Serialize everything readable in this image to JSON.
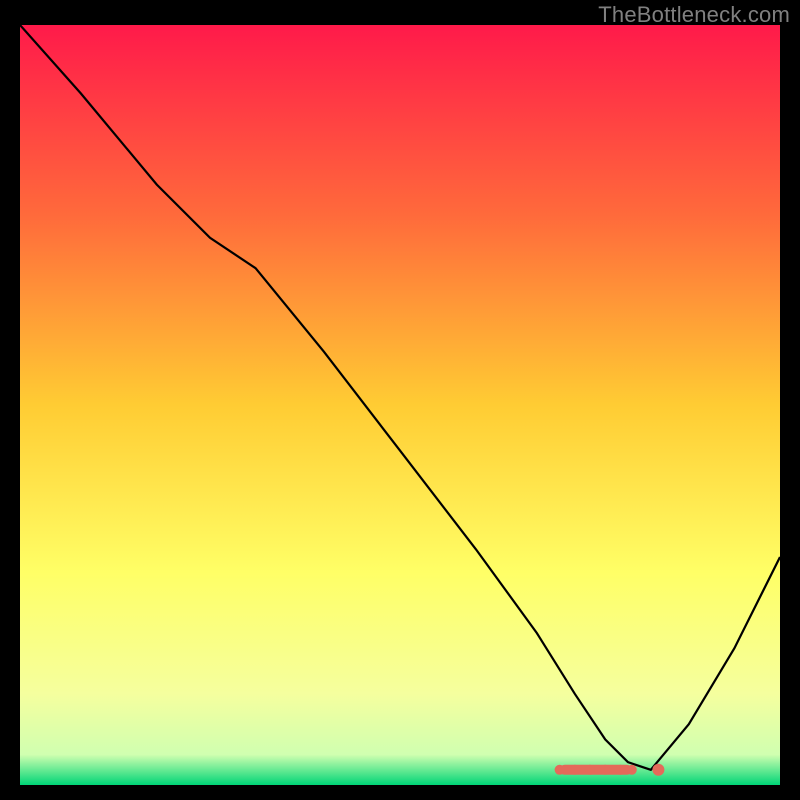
{
  "watermark": "TheBottleneck.com",
  "chart_data": {
    "type": "line",
    "title": "",
    "xlabel": "",
    "ylabel": "",
    "xlim": [
      0,
      100
    ],
    "ylim": [
      0,
      100
    ],
    "grid": false,
    "background": "rainbow-gradient-vertical",
    "gradient_stops": [
      {
        "offset": 0,
        "color": "#ff1a4a"
      },
      {
        "offset": 0.25,
        "color": "#ff6a3b"
      },
      {
        "offset": 0.5,
        "color": "#ffcc33"
      },
      {
        "offset": 0.72,
        "color": "#ffff66"
      },
      {
        "offset": 0.88,
        "color": "#f5ff9e"
      },
      {
        "offset": 0.96,
        "color": "#d0ffb0"
      },
      {
        "offset": 1.0,
        "color": "#00d577"
      }
    ],
    "series": [
      {
        "name": "bottleneck-curve",
        "color": "#000000",
        "x": [
          0,
          8,
          18,
          25,
          31,
          40,
          50,
          60,
          68,
          73,
          77,
          80,
          83,
          88,
          94,
          100
        ],
        "values": [
          100,
          91,
          79,
          72,
          68,
          57,
          44,
          31,
          20,
          12,
          6,
          3,
          2,
          8,
          18,
          30
        ]
      }
    ],
    "markers": {
      "name": "highlight-cluster",
      "color": "#e46a5a",
      "points": [
        {
          "x": 71,
          "y": 2.0
        },
        {
          "x": 73,
          "y": 2.0
        },
        {
          "x": 75,
          "y": 2.0
        },
        {
          "x": 77,
          "y": 2.0
        },
        {
          "x": 79,
          "y": 2.0
        },
        {
          "x": 80.5,
          "y": 2.0
        },
        {
          "x": 84,
          "y": 2.0
        }
      ]
    }
  }
}
